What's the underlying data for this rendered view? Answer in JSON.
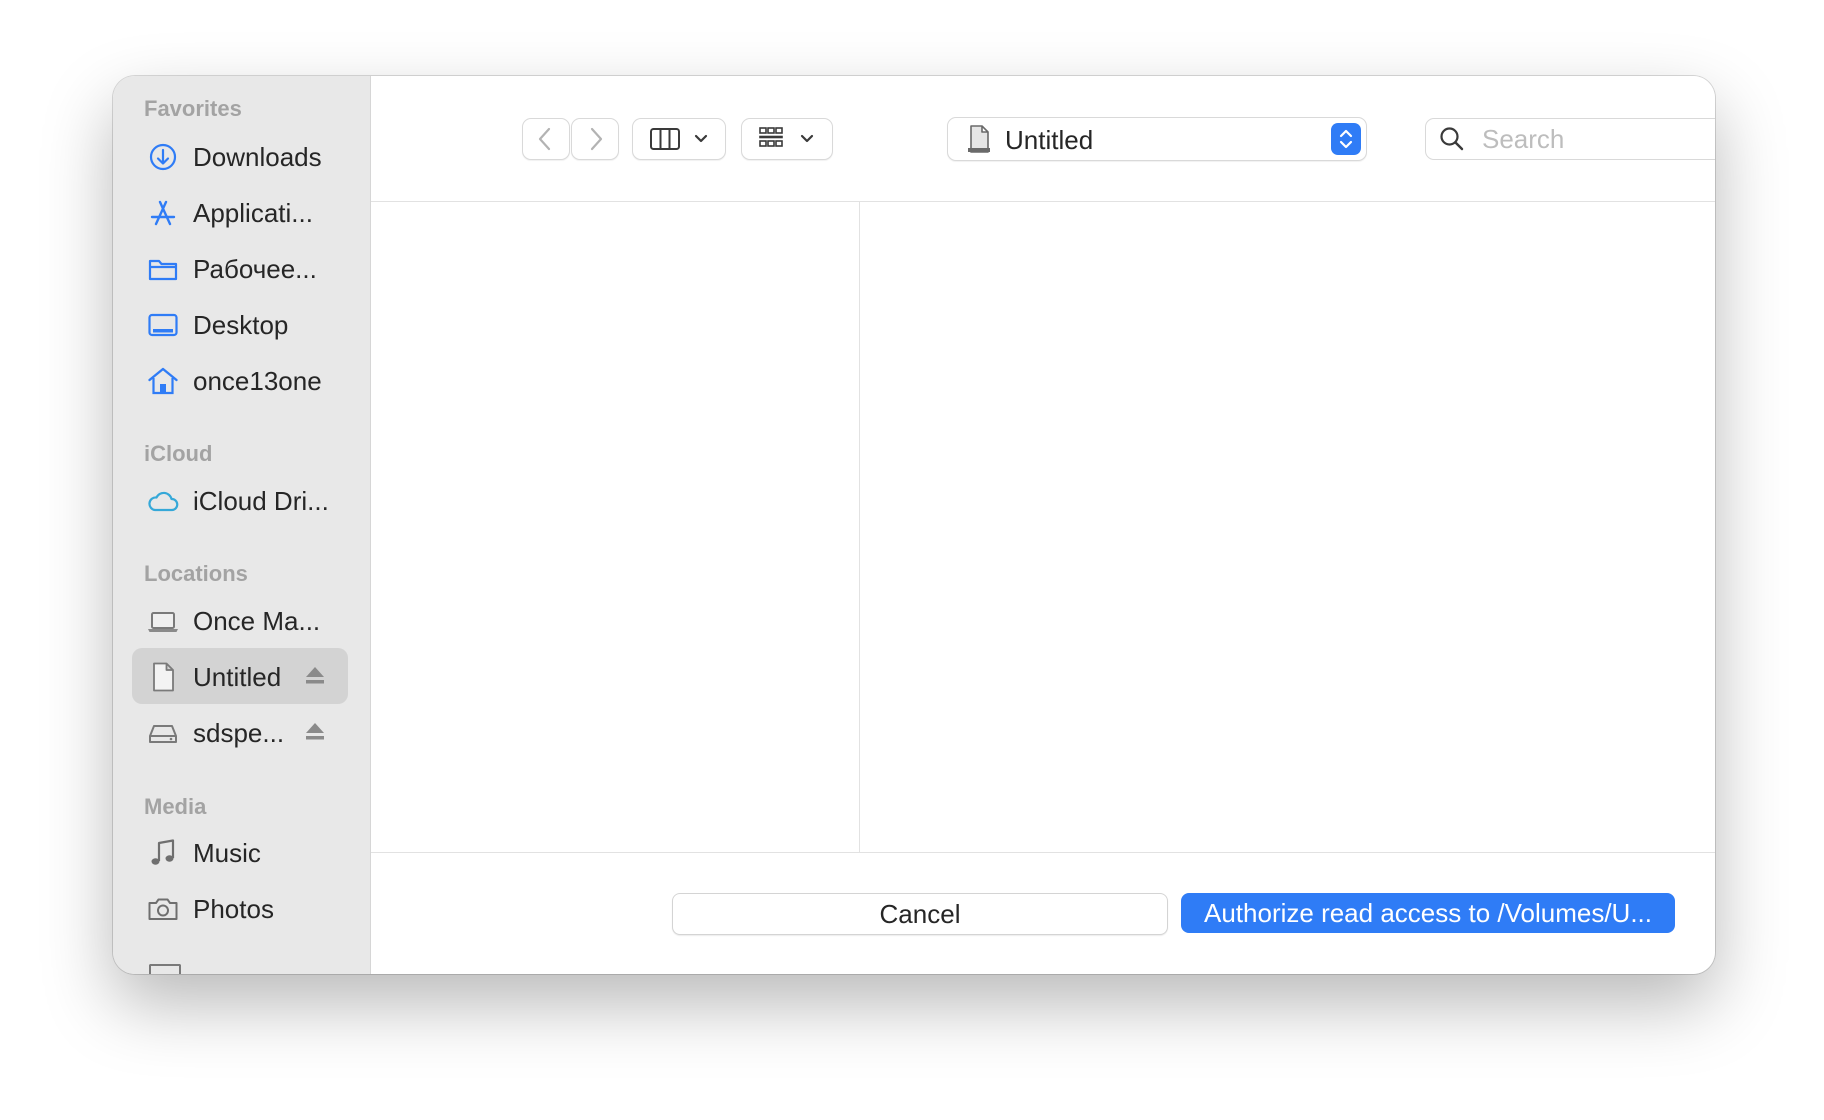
{
  "sidebar": {
    "sections": [
      {
        "title": "Favorites",
        "items": [
          {
            "label": "Downloads",
            "icon": "download-circle-icon"
          },
          {
            "label": "Applicati...",
            "icon": "applications-icon"
          },
          {
            "label": "Рабочее...",
            "icon": "folder-icon"
          },
          {
            "label": "Desktop",
            "icon": "desktop-icon"
          },
          {
            "label": "once13one",
            "icon": "home-icon"
          }
        ]
      },
      {
        "title": "iCloud",
        "items": [
          {
            "label": "iCloud Dri...",
            "icon": "cloud-icon"
          }
        ]
      },
      {
        "title": "Locations",
        "items": [
          {
            "label": "Once Ma...",
            "icon": "laptop-icon"
          },
          {
            "label": "Untitled",
            "icon": "document-icon",
            "selected": true,
            "eject": true
          },
          {
            "label": "sdspe...",
            "icon": "external-drive-icon",
            "eject": true
          }
        ]
      },
      {
        "title": "Media",
        "items": [
          {
            "label": "Music",
            "icon": "music-note-icon"
          },
          {
            "label": "Photos",
            "icon": "camera-icon"
          }
        ]
      }
    ]
  },
  "toolbar": {
    "location": "Untitled",
    "search_placeholder": "Search"
  },
  "footer": {
    "cancel_label": "Cancel",
    "authorize_label": "Authorize read access to  /Volumes/U..."
  },
  "colors": {
    "accent": "#2f7cf6",
    "sidebar_bg": "#e8e8e8",
    "selected_bg": "#d3d3d3",
    "section_title": "#a3a3a3"
  }
}
